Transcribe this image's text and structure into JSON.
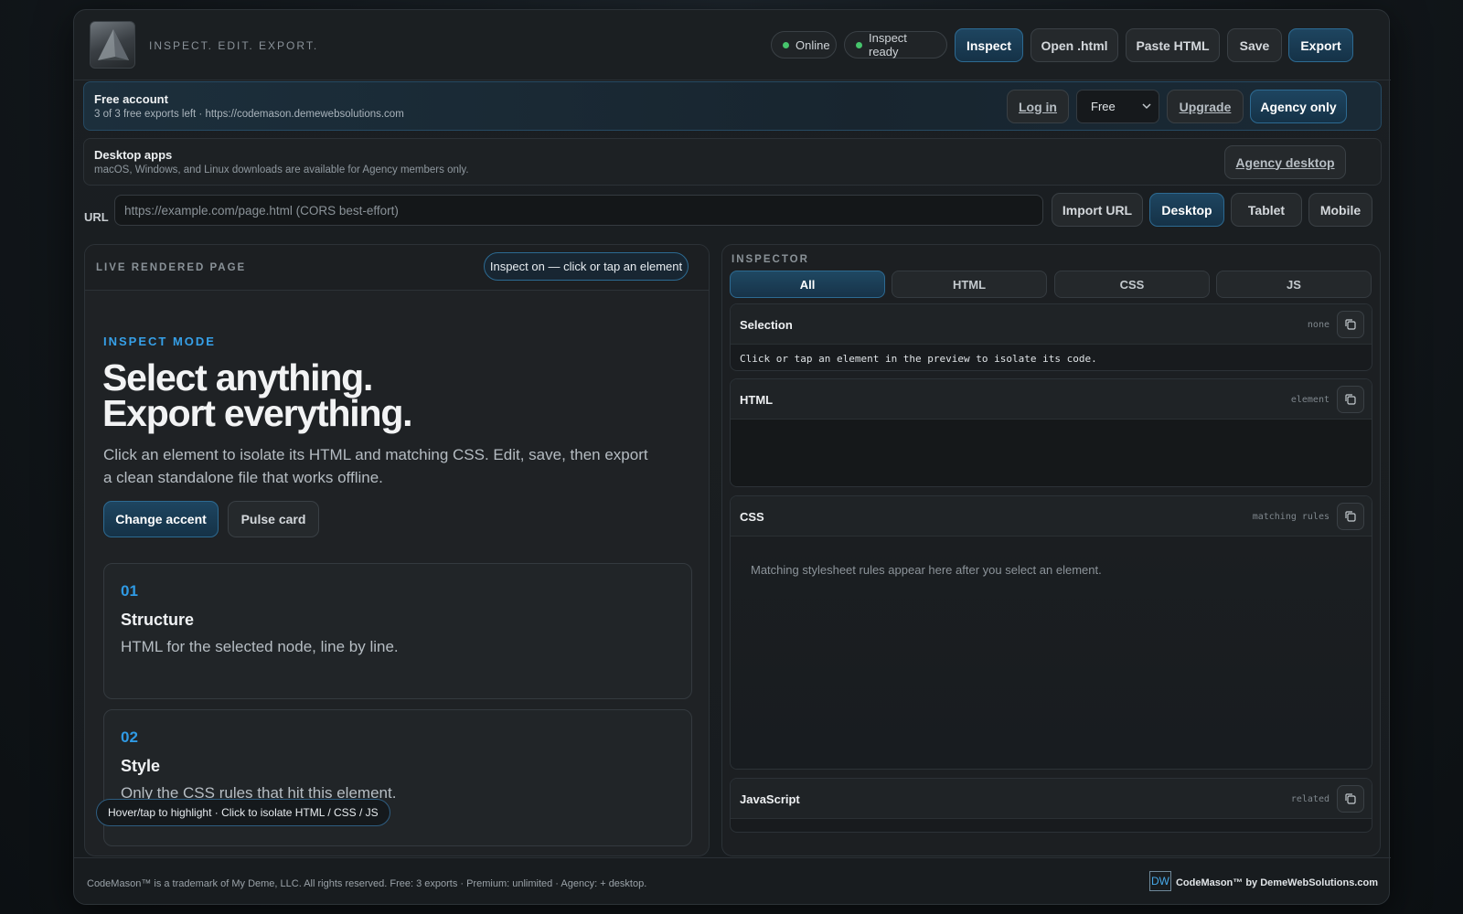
{
  "header": {
    "tagline": "INSPECT. EDIT. EXPORT.",
    "status_online": "Online",
    "status_inspect": "Inspect ready",
    "buttons": {
      "inspect": "Inspect",
      "open_html": "Open .html",
      "paste_html": "Paste HTML",
      "save": "Save",
      "export": "Export"
    }
  },
  "account": {
    "title": "Free account",
    "subtitle": "3 of 3 free exports left · https://codemason.demewebsolutions.com",
    "login": "Log in",
    "plan_select": "Free",
    "upgrade": "Upgrade",
    "agency": "Agency only"
  },
  "desktop_apps": {
    "title": "Desktop apps",
    "subtitle": "macOS, Windows, and Linux downloads are available for Agency members only.",
    "button": "Agency desktop"
  },
  "url_bar": {
    "label": "URL",
    "placeholder": "https://example.com/page.html (CORS best-effort)",
    "import": "Import URL",
    "desktop": "Desktop",
    "tablet": "Tablet",
    "mobile": "Mobile"
  },
  "preview": {
    "header": "LIVE RENDERED PAGE",
    "inspect_status": "Inspect on — click or tap an element",
    "mode_label": "INSPECT MODE",
    "hero_line1": "Select anything.",
    "hero_line2": "Export everything.",
    "description": "Click an element to isolate its HTML and matching CSS. Edit, save, then export a clean standalone file that works offline.",
    "change_accent": "Change accent",
    "pulse_card": "Pulse card",
    "cards": [
      {
        "num": "01",
        "title": "Structure",
        "desc": "HTML for the selected node, line by line."
      },
      {
        "num": "02",
        "title": "Style",
        "desc": "Only the CSS rules that hit this element."
      }
    ],
    "hint": "Hover/tap to highlight · Click to isolate HTML / CSS / JS"
  },
  "inspector": {
    "label": "INSPECTOR",
    "tabs": [
      "All",
      "HTML",
      "CSS",
      "JS"
    ],
    "selection": {
      "title": "Selection",
      "tag": "none",
      "body": "Click or tap an element in the preview to isolate its code."
    },
    "html": {
      "title": "HTML",
      "tag": "element"
    },
    "css": {
      "title": "CSS",
      "tag": "matching rules",
      "body": "Matching stylesheet rules appear here after you select an element."
    },
    "js": {
      "title": "JavaScript",
      "tag": "related"
    }
  },
  "footer": {
    "left": "CodeMason™ is a trademark of My Deme, LLC. All rights reserved. Free: 3 exports · Premium: unlimited · Agency: + desktop.",
    "logo_text": "DW",
    "right": "CodeMason™ by DemeWebSolutions.com"
  },
  "colors": {
    "accent": "#2f9ae4",
    "online": "#46c46c",
    "primary_border": "#2d6a92"
  }
}
